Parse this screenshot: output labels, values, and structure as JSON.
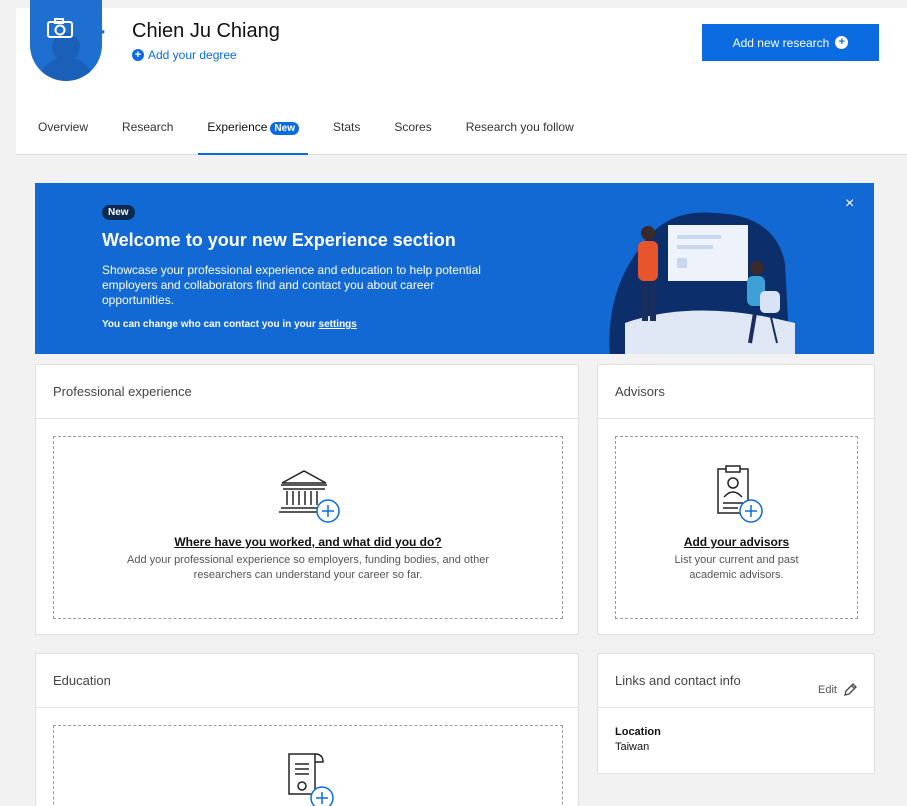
{
  "profile": {
    "name": "Chien Ju Chiang",
    "add_degree": "Add your degree",
    "add_research": "Add new research"
  },
  "tabs": [
    {
      "label": "Overview"
    },
    {
      "label": "Research"
    },
    {
      "label": "Experience",
      "badge": "New",
      "active": true
    },
    {
      "label": "Stats"
    },
    {
      "label": "Scores"
    },
    {
      "label": "Research you follow"
    }
  ],
  "banner": {
    "badge": "New",
    "title": "Welcome to your new Experience section",
    "description": "Showcase your professional experience and education to help potential employers and collaborators find and contact you about career opportunities.",
    "settings_prefix": "You can change who can contact you in your ",
    "settings_link": "settings",
    "close": "×"
  },
  "professional": {
    "title": "Professional experience",
    "link": "Where have you worked, and what did you do?",
    "sub": "Add your professional experience so employers, funding bodies, and other researchers can understand your career so far."
  },
  "advisors": {
    "title": "Advisors",
    "link": "Add your advisors",
    "sub": "List your current and past academic advisors."
  },
  "education": {
    "title": "Education"
  },
  "links": {
    "title": "Links and contact info",
    "edit": "Edit",
    "location_label": "Location",
    "location_value": "Taiwan"
  },
  "colors": {
    "accent": "#0a6ce0",
    "banner": "#1269d3"
  }
}
